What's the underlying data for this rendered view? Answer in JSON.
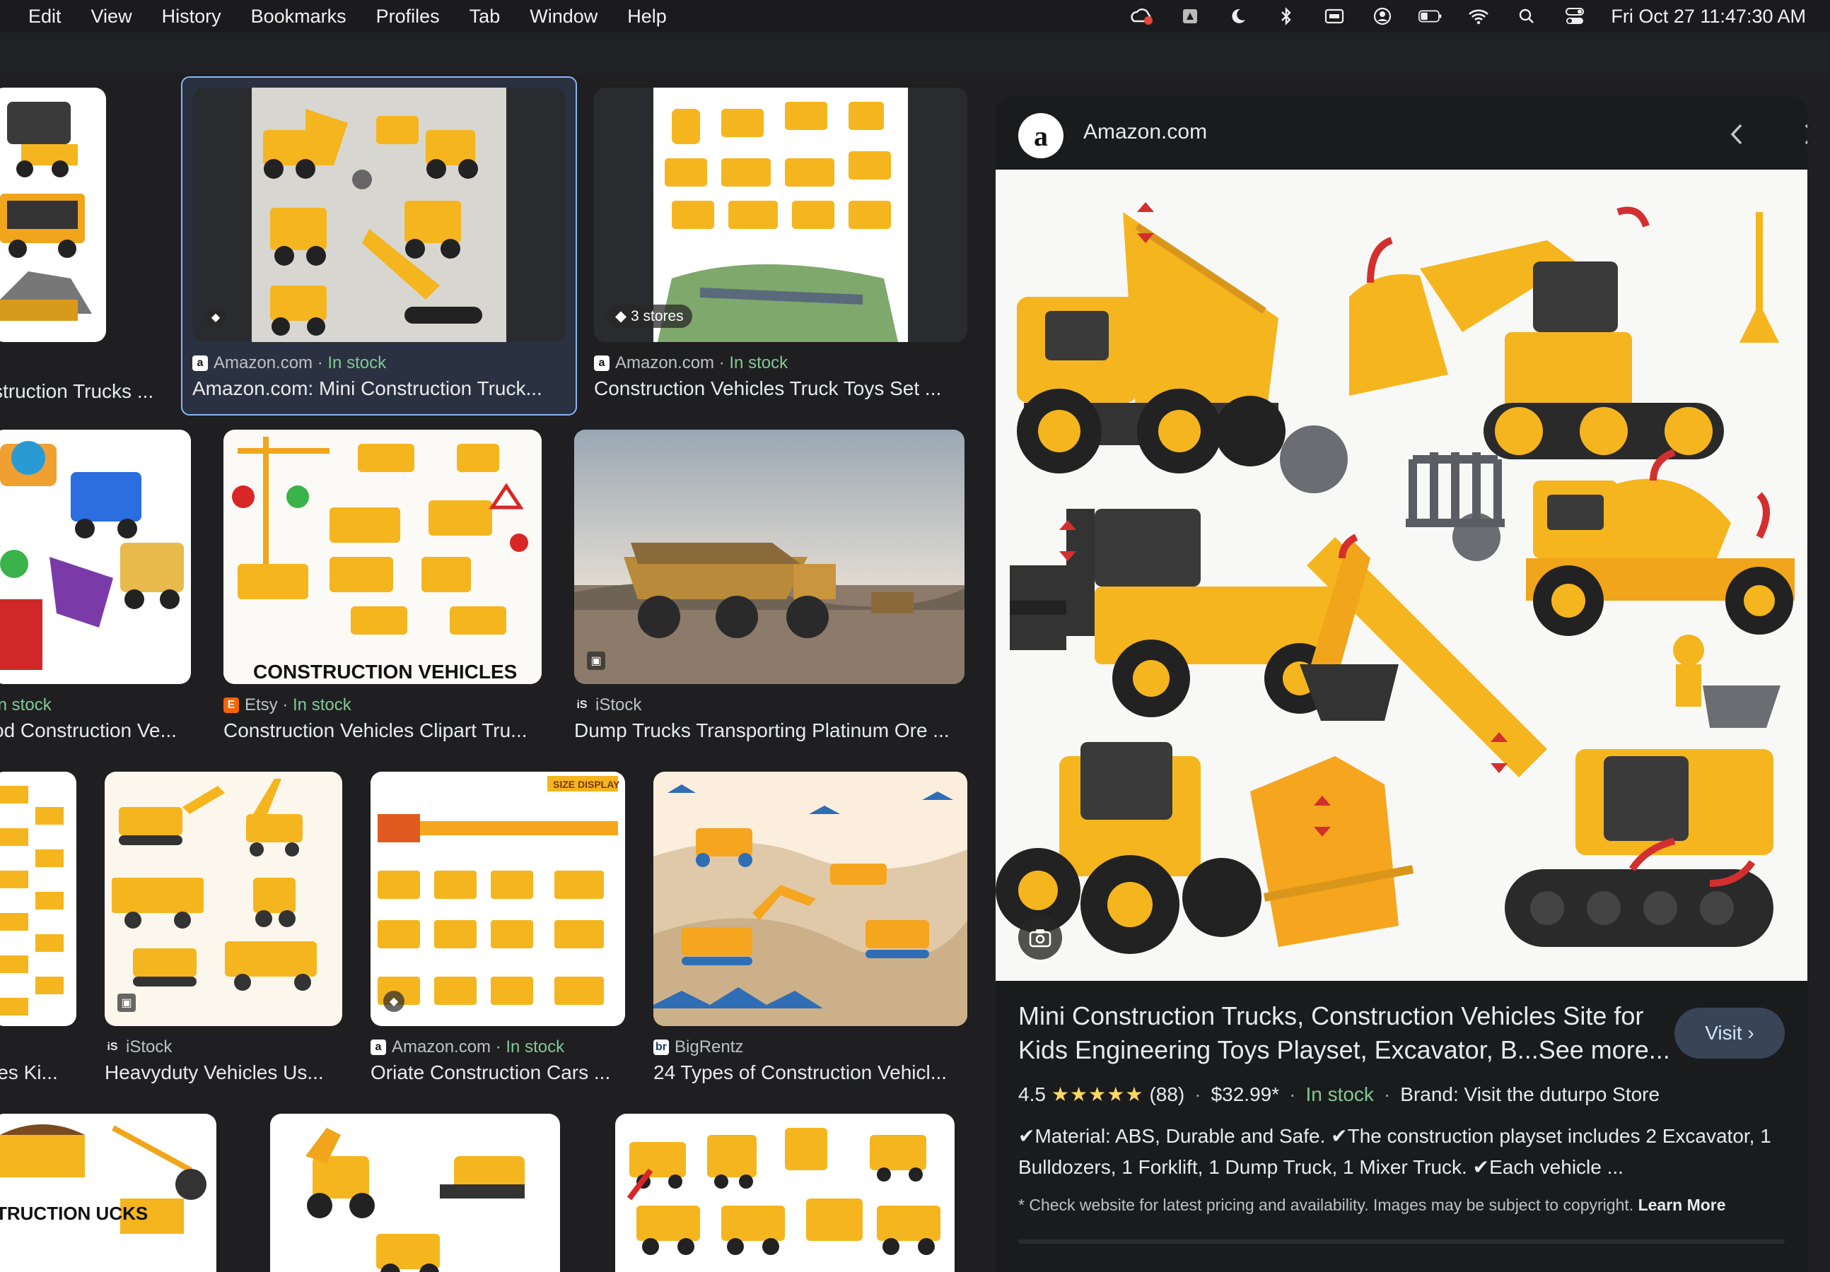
{
  "menubar": {
    "items": [
      "Edit",
      "View",
      "History",
      "Bookmarks",
      "Profiles",
      "Tab",
      "Window",
      "Help"
    ],
    "clock": "Fri Oct 27  11:47:30 AM"
  },
  "results": [
    {
      "source": "",
      "stock": "",
      "title": "struction Trucks ..."
    },
    {
      "source": "Amazon.com",
      "stock": "In stock",
      "title": "Amazon.com: Mini Construction Truck..."
    },
    {
      "source": "Amazon.com",
      "stock": "In stock",
      "title": "Construction Vehicles Truck Toys Set ...",
      "badge": "3 stores"
    },
    {
      "source": "",
      "stock": "In stock",
      "title": "od Construction Ve..."
    },
    {
      "source": "Etsy",
      "stock": "In stock",
      "title": "Construction Vehicles Clipart Tru...",
      "image_text": "CONSTRUCTION VEHICLES"
    },
    {
      "source": "iStock",
      "stock": "",
      "title": "Dump Trucks Transporting Platinum Ore ..."
    },
    {
      "source": "",
      "stock": "",
      "title": "les Ki..."
    },
    {
      "source": "iStock",
      "stock": "",
      "title": "Heavyduty Vehicles Us..."
    },
    {
      "source": "Amazon.com",
      "stock": "In stock",
      "title": "Oriate Construction Cars ...",
      "image_text": "SIZE DISPLAY"
    },
    {
      "source": "BigRentz",
      "stock": "",
      "title": "24 Types of Construction Vehicl..."
    },
    {
      "source": "",
      "stock": "",
      "title": "",
      "image_text": "TRUCTION UCKS"
    }
  ],
  "panel": {
    "site": "Amazon.com",
    "title": "Mini Construction Trucks, Construction Vehicles Site for Kids Engineering Toys Playset, Excavator, B...See more...",
    "visit_label": "Visit",
    "rating": "4.5",
    "stars": "★★★★★",
    "reviews": "(88)",
    "price": "$32.99*",
    "stock": "In stock",
    "brand": "Brand: Visit the duturpo Store",
    "description": "✔Material: ABS, Durable and Safe. ✔The construction playset includes 2 Excavator, 1 Bulldozers, 1 Forklift, 1 Dump Truck, 1 Mixer Truck. ✔Each vehicle ...",
    "disclaimer": "* Check website for latest pricing and availability. Images may be subject to copyright.",
    "learn_more": "Learn More"
  },
  "colors": {
    "accent": "#8ab4f8",
    "in_stock": "#81c995",
    "toy_yellow": "#f5b51e"
  }
}
